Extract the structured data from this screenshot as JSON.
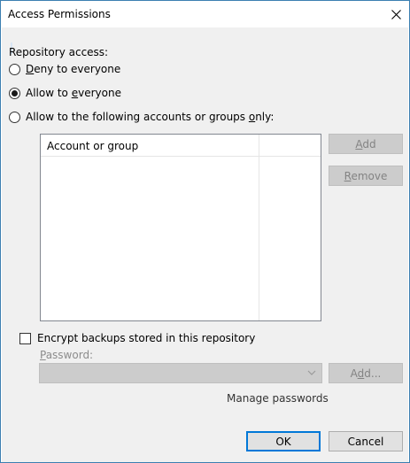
{
  "window": {
    "title": "Access Permissions",
    "close_icon": "close-icon"
  },
  "repository_access": {
    "heading": "Repository access:",
    "options": [
      {
        "before": "",
        "mnemonic": "D",
        "after": "eny to everyone",
        "checked": false
      },
      {
        "before": "Allow to ",
        "mnemonic": "e",
        "after": "veryone",
        "checked": true
      },
      {
        "before": "Allow to the following accounts or groups ",
        "mnemonic": "o",
        "after": "nly:",
        "checked": false
      }
    ]
  },
  "accounts_list": {
    "column_header": "Account or group",
    "rows": []
  },
  "list_buttons": {
    "add": {
      "mnemonic": "A",
      "rest": "dd"
    },
    "remove": {
      "mnemonic": "R",
      "rest": "emove"
    }
  },
  "encryption": {
    "checkbox_label": "Encrypt backups stored in this repository",
    "checked": false,
    "password_label_mnemonic": "P",
    "password_label_rest": "assword:",
    "password_value": "",
    "add_button": {
      "before": "A",
      "mnemonic": "d",
      "after": "d..."
    },
    "manage_link": "Manage passwords"
  },
  "footer": {
    "ok": "OK",
    "cancel": "Cancel"
  },
  "colors": {
    "window_border": "#3c7fb1",
    "dialog_bg": "#f0f0f0",
    "default_button_border": "#0078d7"
  }
}
